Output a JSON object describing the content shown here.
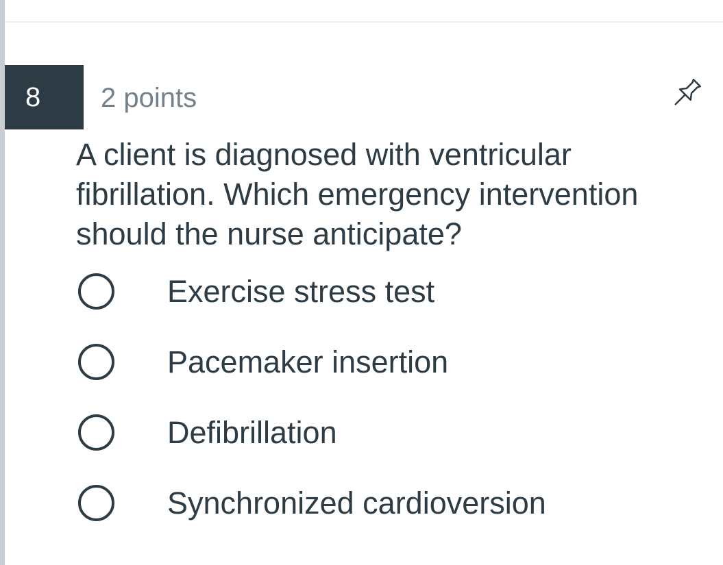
{
  "question": {
    "number": "8",
    "points": "2 points",
    "text": "A client is diagnosed with ventricular fibrillation.  Which emergency intervention should the nurse anticipate?",
    "pin_icon": "pin-icon",
    "answers": [
      {
        "label": "Exercise stress test",
        "selected": false
      },
      {
        "label": "Pacemaker insertion",
        "selected": false
      },
      {
        "label": "Defibrillation",
        "selected": false
      },
      {
        "label": "Synchronized cardioversion",
        "selected": false
      }
    ]
  },
  "colors": {
    "text": "#2d3b45",
    "muted": "#73818c",
    "number_background": "#2d3b45"
  }
}
